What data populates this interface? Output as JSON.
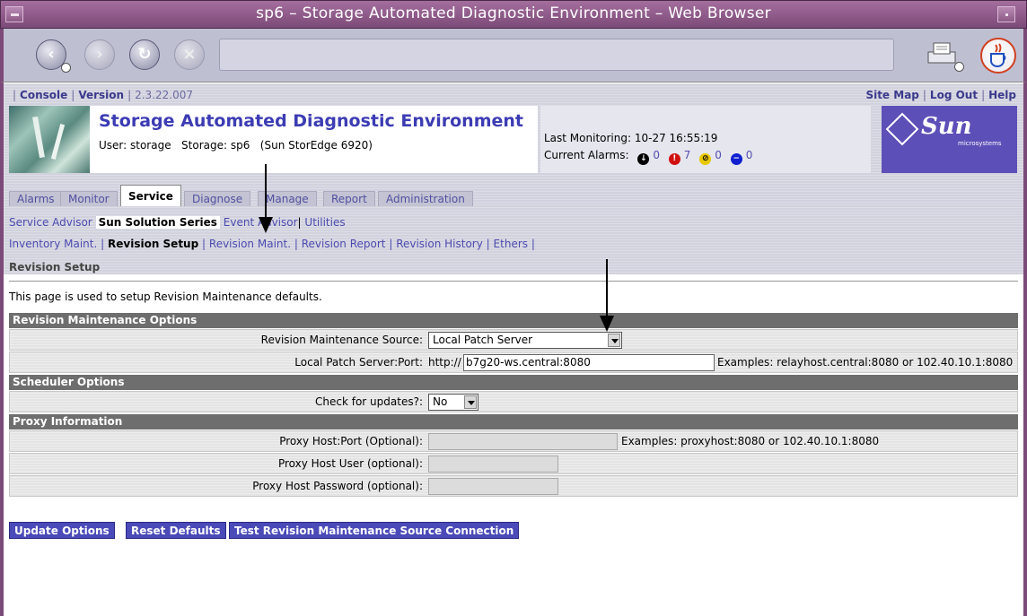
{
  "window": {
    "title": "sp6 – Storage Automated Diagnostic Environment – Web Browser"
  },
  "utility_bar": {
    "console": "Console",
    "version_label": "Version",
    "version": "2.3.22.007",
    "site_map": "Site Map",
    "log_out": "Log Out",
    "help": "Help"
  },
  "header": {
    "app_title": "Storage Automated Diagnostic Environment",
    "user_line": "User: storage   Storage: sp6   (Sun StorEdge 6920)",
    "last_monitoring": "Last Monitoring: 10-27 16:55:19",
    "current_alarms_label": "Current Alarms:",
    "alarms": [
      {
        "count": "0",
        "color": "#000000",
        "glyph": "↓"
      },
      {
        "count": "7",
        "color": "#d01010",
        "glyph": "!"
      },
      {
        "count": "0",
        "color": "#e8c800",
        "glyph": "⊘"
      },
      {
        "count": "0",
        "color": "#1020d0",
        "glyph": "−"
      }
    ],
    "logo_text": "Sun",
    "logo_subtext": "microsystems"
  },
  "tabs": [
    "Alarms",
    "Monitor",
    "Service",
    "Diagnose",
    "Manage",
    "Report",
    "Administration"
  ],
  "active_tab": "Service",
  "subtabs": {
    "service_advisor": "Service Advisor",
    "sun_solution_series": "Sun Solution Series",
    "event_advisor": "Event Advisor",
    "utilities": "Utilities"
  },
  "subnav": {
    "inventory_maint": "Inventory Maint.",
    "revision_setup": "Revision Setup",
    "revision_maint": "Revision Maint.",
    "revision_report": "Revision Report",
    "revision_history": "Revision History",
    "ethers": "Ethers"
  },
  "page_heading": "Revision Setup",
  "intro": "This page is used to setup Revision Maintenance defaults.",
  "sections": {
    "revision_options": "Revision Maintenance Options",
    "scheduler_options": "Scheduler Options",
    "proxy_information": "Proxy Information"
  },
  "fields": {
    "source_label": "Revision Maintenance Source:",
    "source_value": "Local Patch Server",
    "server_port_label": "Local Patch Server:Port:",
    "server_prefix": "http://",
    "server_value": "b7g20-ws.central:8080",
    "server_examples": "Examples: relayhost.central:8080 or 102.40.10.1:8080",
    "check_label": "Check for updates?:",
    "check_value": "No",
    "proxy_host_label": "Proxy Host:Port (Optional):",
    "proxy_examples": "Examples: proxyhost:8080 or 102.40.10.1:8080",
    "proxy_user_label": "Proxy Host User (optional):",
    "proxy_password_label": "Proxy Host Password (optional):"
  },
  "buttons": {
    "update": "Update Options",
    "reset": "Reset Defaults",
    "test": "Test Revision Maintenance Source Connection"
  }
}
